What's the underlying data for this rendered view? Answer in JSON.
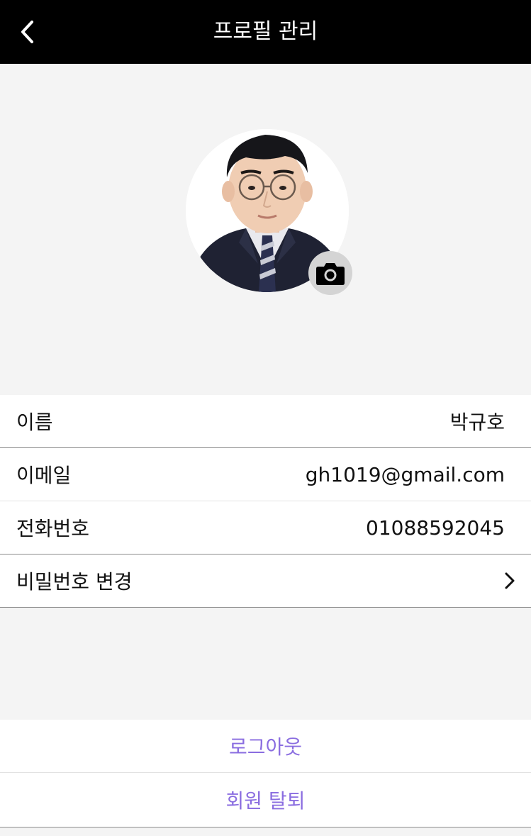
{
  "header": {
    "title": "프로필 관리",
    "back_icon": "chevron-left-icon"
  },
  "profile": {
    "avatar_icon": "profile-photo",
    "camera_icon": "camera-icon"
  },
  "fields": {
    "name_label": "이름",
    "name_value": "박규호",
    "email_label": "이메일",
    "email_value": "gh1019@gmail.com",
    "phone_label": "전화번호",
    "phone_value": "01088592045",
    "password_label": "비밀번호 변경",
    "password_chevron_icon": "chevron-right-icon"
  },
  "actions": {
    "logout_label": "로그아웃",
    "withdraw_label": "회원 탈퇴"
  },
  "colors": {
    "header_bg": "#000000",
    "page_bg": "#f4f4f4",
    "accent": "#8a6de0"
  }
}
